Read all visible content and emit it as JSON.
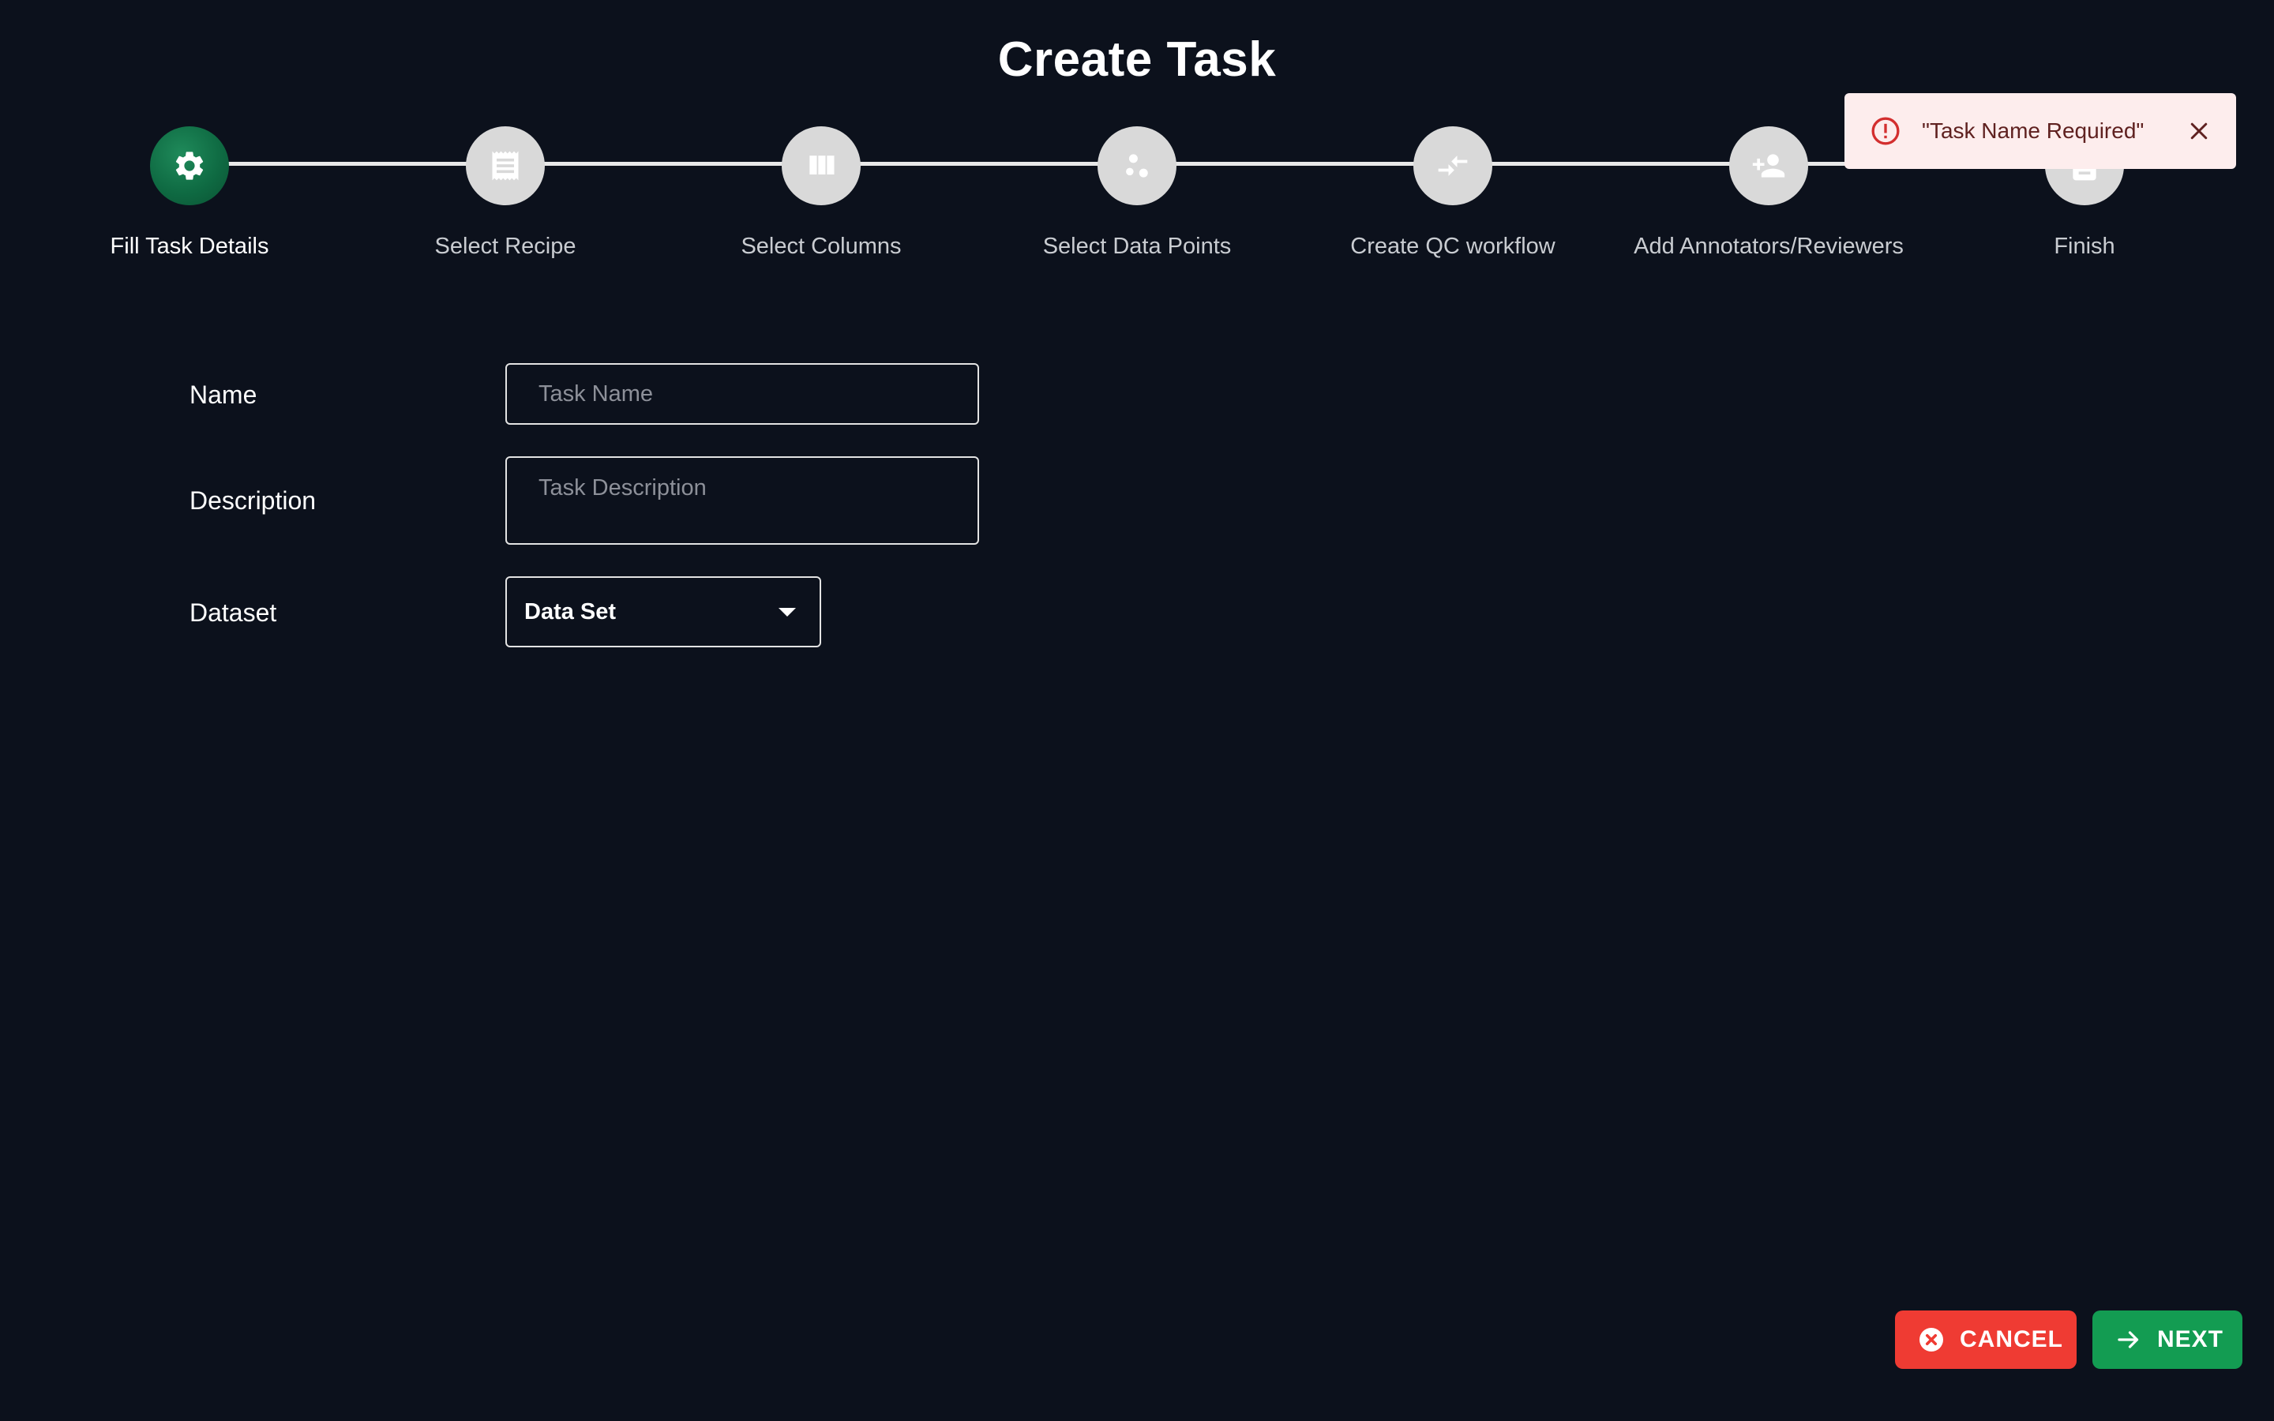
{
  "page": {
    "title": "Create Task"
  },
  "stepper": {
    "steps": [
      {
        "label": "Fill Task Details",
        "icon": "gear-icon",
        "active": true
      },
      {
        "label": "Select Recipe",
        "icon": "receipt-icon",
        "active": false
      },
      {
        "label": "Select Columns",
        "icon": "columns-icon",
        "active": false
      },
      {
        "label": "Select Data Points",
        "icon": "scatter-points-icon",
        "active": false
      },
      {
        "label": "Create QC workflow",
        "icon": "compare-arrows-icon",
        "active": false
      },
      {
        "label": "Add Annotators/Reviewers",
        "icon": "add-user-icon",
        "active": false
      },
      {
        "label": "Finish",
        "icon": "document-icon",
        "active": false
      }
    ]
  },
  "form": {
    "name": {
      "label": "Name",
      "value": "",
      "placeholder": "Task Name"
    },
    "description": {
      "label": "Description",
      "value": "",
      "placeholder": "Task Description"
    },
    "dataset": {
      "label": "Dataset",
      "selected": "Data Set"
    }
  },
  "toast": {
    "message": "\"Task Name Required\"",
    "icon": "error-circle-icon"
  },
  "actions": {
    "cancel_label": "CANCEL",
    "next_label": "NEXT"
  },
  "colors": {
    "background": "#0c111c",
    "active_step": "#0f6b43",
    "cancel": "#ef3b33",
    "next": "#139c52",
    "toast_bg": "#fdeded",
    "toast_text": "#5f2120",
    "error_icon": "#d32f2f"
  }
}
